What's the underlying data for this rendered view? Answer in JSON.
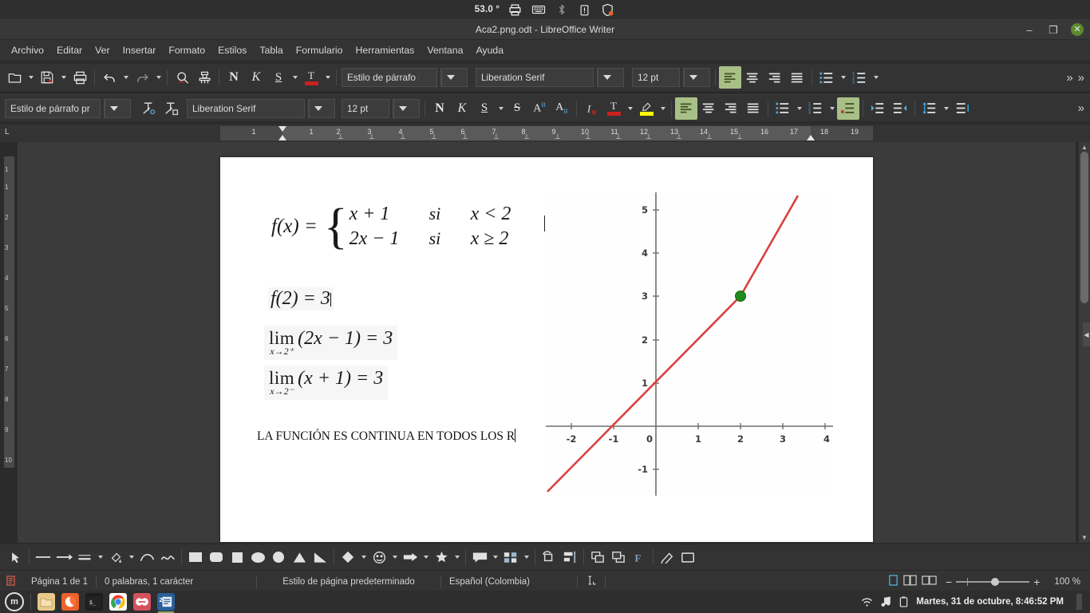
{
  "system_bar": {
    "temperature": "53.0 °",
    "icons": [
      "printer-icon",
      "keyboard-icon",
      "bluetooth-icon",
      "clipboard-icon",
      "shield-icon"
    ]
  },
  "window": {
    "title": "Aca2.png.odt - LibreOffice Writer",
    "minimize": "–",
    "restore": "❐",
    "close": "✕"
  },
  "menubar": {
    "items": [
      {
        "label": "Archivo"
      },
      {
        "label": "Editar"
      },
      {
        "label": "Ver"
      },
      {
        "label": "Insertar"
      },
      {
        "label": "Formato"
      },
      {
        "label": "Estilos"
      },
      {
        "label": "Tabla"
      },
      {
        "label": "Formulario"
      },
      {
        "label": "Herramientas"
      },
      {
        "label": "Ventana"
      },
      {
        "label": "Ayuda"
      }
    ]
  },
  "toolbar_standard": {
    "paragraph_style": "Estilo de párrafo pr",
    "font_name": "Liberation Serif",
    "font_size": "12 pt",
    "overflow": "»",
    "buttons": [
      "open-icon",
      "save-icon",
      "print-icon",
      "undo-icon",
      "redo-icon",
      "find-replace-icon",
      "clone-formatting-icon",
      "bold-icon",
      "italic-icon",
      "underline-icon",
      "font-color-icon",
      "align-left-icon",
      "align-center-icon",
      "align-right-icon",
      "justify-icon",
      "bullet-list-icon",
      "numbered-list-icon"
    ],
    "bold_glyph": "N",
    "italic_glyph": "K",
    "underline_glyph": "S",
    "fontcolor_glyph": "T"
  },
  "toolbar_formatting": {
    "paragraph_style": "Estilo de párrafo pr",
    "font_name": "Liberation Serif",
    "font_size": "12 pt",
    "bold_glyph": "N",
    "italic_glyph": "K",
    "underline_glyph": "S",
    "strikethrough_glyph": "S",
    "superscript_glyph": "A",
    "superscript_mark": "B",
    "subscript_glyph": "A",
    "subscript_mark": "B",
    "clear_format_glyph": "I",
    "fontcolor_glyph": "T",
    "font_color": "#c9211e",
    "highlight_color": "#ffff00",
    "overflow": "»"
  },
  "ruler": {
    "numbers": [
      "1",
      "1",
      "2",
      "3",
      "4",
      "5",
      "6",
      "7",
      "8",
      "9",
      "10",
      "11",
      "12",
      "13",
      "14",
      "15",
      "16",
      "17",
      "18",
      "19"
    ],
    "vertical_numbers": [
      "1",
      "1",
      "2",
      "3",
      "4",
      "5",
      "6",
      "7",
      "8",
      "9",
      "10"
    ],
    "corner_label": "L"
  },
  "document": {
    "equation_fx": {
      "lhs": "f(x) =",
      "brace": "{",
      "case1": {
        "expr": "x + 1",
        "si": "si",
        "cond": "x < 2"
      },
      "case2": {
        "expr": "2x − 1",
        "si": "si",
        "cond": "x ≥ 2"
      }
    },
    "equation_f2": "f(2) = 3",
    "limit_right": {
      "word": "lim",
      "sub": "x→2⁺",
      "rest": "(2x − 1) = 3"
    },
    "limit_left": {
      "word": "lim",
      "sub": "x→2⁻",
      "rest": "(x + 1) = 3"
    },
    "conclusion_text": "LA FUNCIÓN ES CONTINUA EN TODOS LOS R"
  },
  "chart_data": {
    "type": "line",
    "title": "",
    "xlabel": "",
    "ylabel": "",
    "xlim": [
      -2.6,
      4.2
    ],
    "ylim": [
      -1.6,
      5.4
    ],
    "xticks": [
      -2,
      -1,
      0,
      1,
      2,
      3,
      4
    ],
    "yticks": [
      -1,
      1,
      2,
      3,
      4,
      5
    ],
    "xtick_labels": [
      "-2",
      "-1",
      "0",
      "1",
      "2",
      "3",
      "4"
    ],
    "ytick_labels": [
      "-1",
      "1",
      "2",
      "3",
      "4",
      "5"
    ],
    "grid": false,
    "legend": "none",
    "line_color": "#d9413f",
    "point_color": "#1e8c1e",
    "series": [
      {
        "name": "x + 1  (x < 2)",
        "points": [
          [
            -2.6,
            -1.6
          ],
          [
            2,
            3
          ]
        ]
      },
      {
        "name": "2x - 1  (x >= 2)",
        "points": [
          [
            2,
            3
          ],
          [
            3.3,
            5.6
          ]
        ]
      }
    ],
    "annotations": [
      {
        "type": "point",
        "x": 2,
        "y": 3,
        "label": "f(2) = 3",
        "color": "#1e8c1e"
      }
    ]
  },
  "statusbar": {
    "page": "Página 1 de 1",
    "words": "0 palabras, 1 carácter",
    "page_style": "Estilo de página predeterminado",
    "language": "Español (Colombia)",
    "selection_mode": "selection-mode-icon",
    "view_single": "single-page-view-icon",
    "view_multi": "multi-page-view-icon",
    "view_book": "book-view-icon",
    "zoom_out": "−",
    "zoom_in": "+",
    "zoom_level": "100 %"
  },
  "taskbar": {
    "menu_glyph": "m",
    "apps": [
      {
        "name": "files-icon",
        "color": "#e8c98a"
      },
      {
        "name": "firefox-icon",
        "color": "#e8622c"
      },
      {
        "name": "terminal-icon",
        "color": "#1d1d1d"
      },
      {
        "name": "chrome-icon",
        "color": "#ffffff"
      },
      {
        "name": "anydesk-icon",
        "color": "#d5515b"
      },
      {
        "name": "libreoffice-writer-icon",
        "color": "#2a6099"
      }
    ],
    "tray": [
      "wifi-icon",
      "music-icon",
      "battery-icon"
    ],
    "clock": "Martes, 31 de octubre,  8:46:52 PM"
  }
}
